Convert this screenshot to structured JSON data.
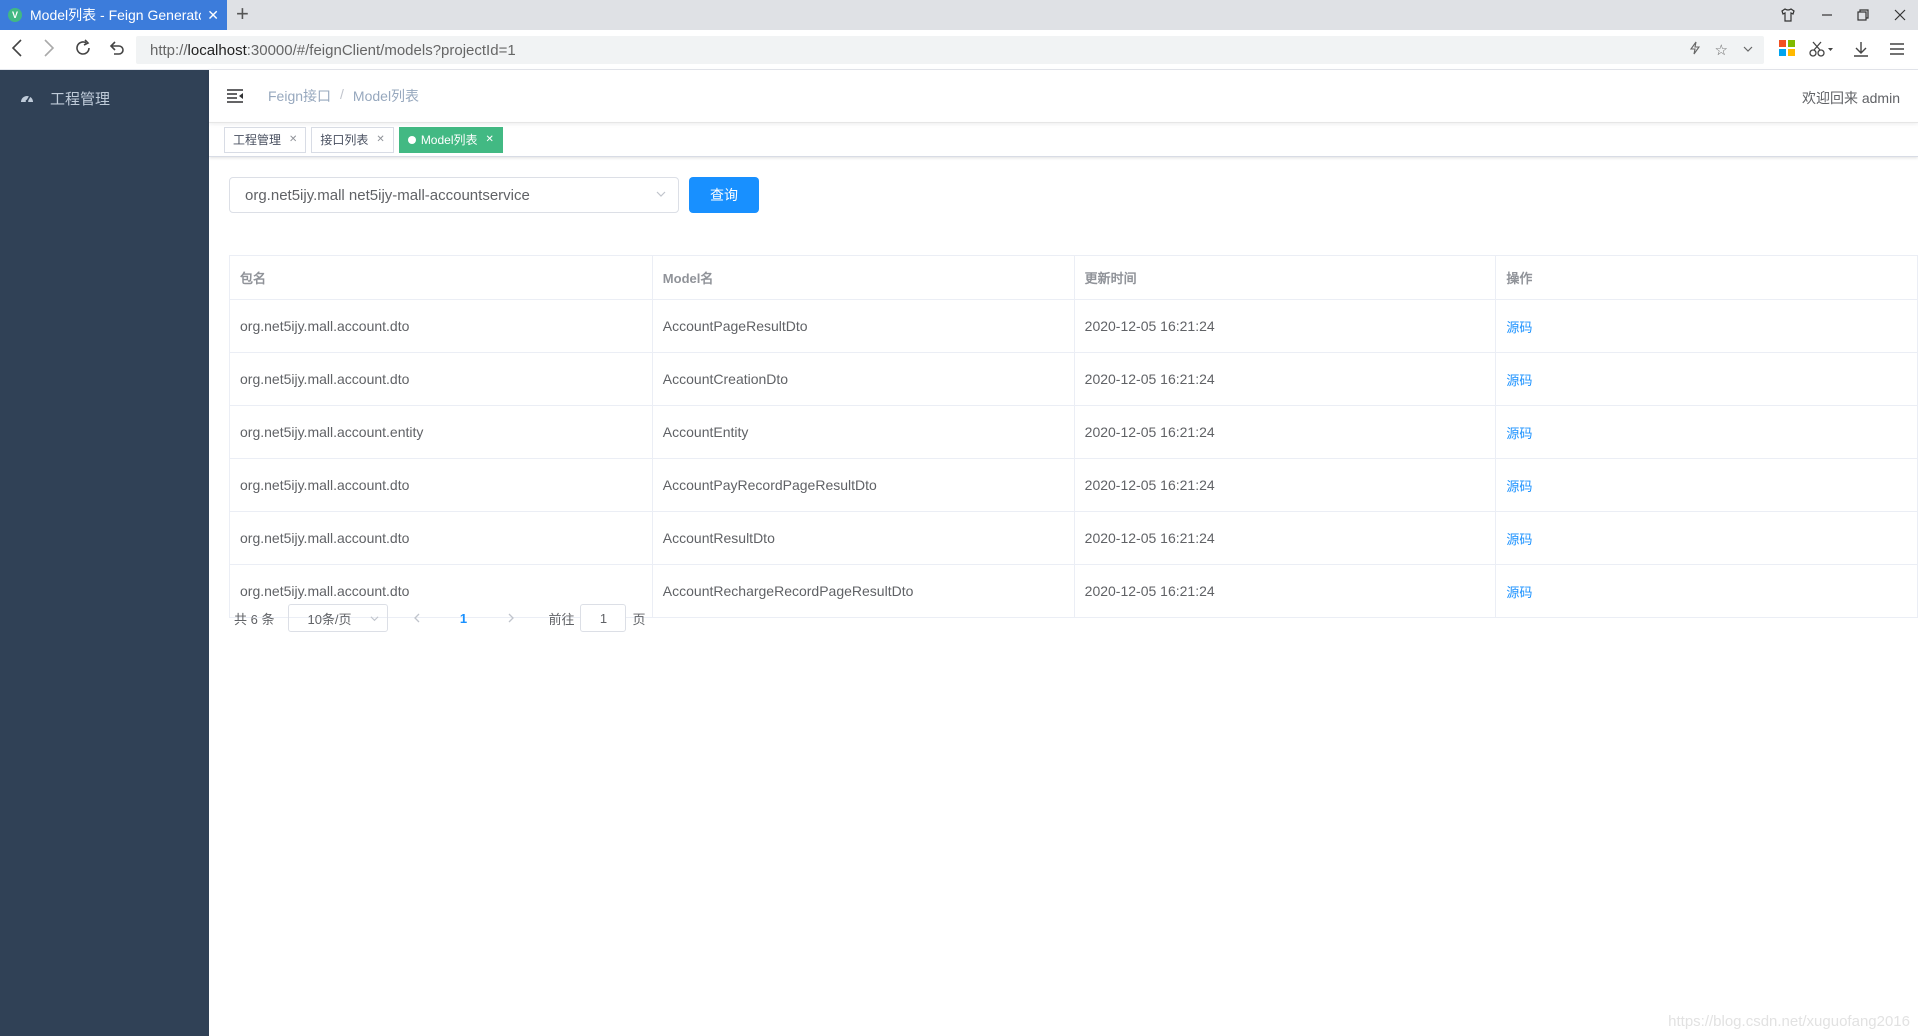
{
  "browser": {
    "tab_title": "Model列表 - Feign Generator",
    "favicon_letter": "V",
    "url_prefix": "http://",
    "url_host": "localhost",
    "url_rest": ":30000/#/feignClient/models?projectId=1"
  },
  "sidebar": {
    "items": [
      {
        "label": "工程管理",
        "icon": "dashboard-icon"
      }
    ]
  },
  "navbar": {
    "breadcrumb": [
      "Feign接口",
      "Model列表"
    ],
    "welcome": "欢迎回来 admin"
  },
  "tags": [
    {
      "label": "工程管理",
      "active": false
    },
    {
      "label": "接口列表",
      "active": false
    },
    {
      "label": "Model列表",
      "active": true
    }
  ],
  "filter": {
    "selected_project": "org.net5ijy.mall net5ijy-mall-accountservice",
    "query_button": "查询"
  },
  "table": {
    "headers": [
      "包名",
      "Model名",
      "更新时间",
      "操作"
    ],
    "rows": [
      {
        "package": "org.net5ijy.mall.account.dto",
        "model": "AccountPageResultDto",
        "updated": "2020-12-05 16:21:24",
        "action": "源码"
      },
      {
        "package": "org.net5ijy.mall.account.dto",
        "model": "AccountCreationDto",
        "updated": "2020-12-05 16:21:24",
        "action": "源码"
      },
      {
        "package": "org.net5ijy.mall.account.entity",
        "model": "AccountEntity",
        "updated": "2020-12-05 16:21:24",
        "action": "源码"
      },
      {
        "package": "org.net5ijy.mall.account.dto",
        "model": "AccountPayRecordPageResultDto",
        "updated": "2020-12-05 16:21:24",
        "action": "源码"
      },
      {
        "package": "org.net5ijy.mall.account.dto",
        "model": "AccountResultDto",
        "updated": "2020-12-05 16:21:24",
        "action": "源码"
      },
      {
        "package": "org.net5ijy.mall.account.dto",
        "model": "AccountRechargeRecordPageResultDto",
        "updated": "2020-12-05 16:21:24",
        "action": "源码"
      }
    ]
  },
  "pagination": {
    "total": "共 6 条",
    "page_size": "10条/页",
    "current_page": "1",
    "goto_label": "前往",
    "goto_value": "1",
    "page_suffix": "页"
  },
  "watermark": "https://blog.csdn.net/xuguofang2016",
  "colors": {
    "sidebar_bg": "#304156",
    "primary": "#1890ff",
    "active_tag": "#42b983"
  }
}
